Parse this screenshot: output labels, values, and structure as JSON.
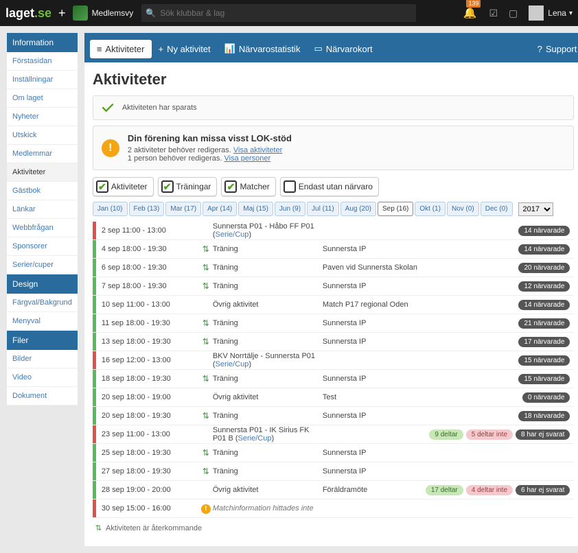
{
  "top": {
    "logo1": "laget",
    "logo2": ".se",
    "memberview": "Medlemsvy",
    "search_placeholder": "Sök klubbar & lag",
    "notif_count": "139",
    "username": "Lena"
  },
  "sidebar": {
    "sections": [
      {
        "title": "Information",
        "items": [
          "Förstasidan",
          "Inställningar",
          "Om laget",
          "Nyheter",
          "Utskick",
          "Medlemmar",
          "Aktiviteter",
          "Gästbok",
          "Länkar",
          "Webbfrågan",
          "Sponsorer",
          "Serier/cuper"
        ],
        "active": 6
      },
      {
        "title": "Design",
        "items": [
          "Färgval/Bakgrund",
          "Menyval"
        ],
        "active": -1
      },
      {
        "title": "Filer",
        "items": [
          "Bilder",
          "Video",
          "Dokument"
        ],
        "active": -1
      }
    ]
  },
  "tabs": {
    "t1": "Aktiviteter",
    "t2": "Ny aktivitet",
    "t3": "Närvarostatistik",
    "t4": "Närvarokort",
    "support": "Support"
  },
  "page_title": "Aktiviteter",
  "saved_msg": "Aktiviteten har sparats",
  "warn": {
    "title": "Din förening kan missa visst LOK-stöd",
    "line1a": "2 aktiviteter behöver redigeras. ",
    "link1": "Visa aktiviteter",
    "line2a": "1 person behöver redigeras. ",
    "link2": "Visa personer"
  },
  "filters": {
    "f1": "Aktiviteter",
    "f2": "Träningar",
    "f3": "Matcher",
    "f4": "Endast utan närvaro"
  },
  "months": [
    "Jan (10)",
    "Feb (13)",
    "Mar (17)",
    "Apr (14)",
    "Maj (15)",
    "Jun (9)",
    "Jul (11)",
    "Aug (20)",
    "Sep (16)",
    "Okt (1)",
    "Nov (0)",
    "Dec (0)"
  ],
  "month_active": 8,
  "year": "2017",
  "rows": [
    {
      "color": "red",
      "time": "2 sep 11:00 - 13:00",
      "icon": "",
      "activity_html": "Sunnersta P01 - Håbo FF P01 (<a>Serie/Cup</a>)",
      "loc": "",
      "badges": [
        {
          "t": "dark",
          "txt": "14 närvarade"
        }
      ]
    },
    {
      "color": "green",
      "time": "4 sep 18:00 - 19:30",
      "icon": "recur",
      "activity_html": "Träning",
      "loc": "Sunnersta IP",
      "badges": [
        {
          "t": "dark",
          "txt": "14 närvarade"
        }
      ]
    },
    {
      "color": "green",
      "time": "6 sep 18:00 - 19:30",
      "icon": "recur",
      "activity_html": "Träning",
      "loc": "Paven vid Sunnersta Skolan",
      "badges": [
        {
          "t": "dark",
          "txt": "20 närvarade"
        }
      ]
    },
    {
      "color": "green",
      "time": "7 sep 18:00 - 19:30",
      "icon": "recur",
      "activity_html": "Träning",
      "loc": "Sunnersta IP",
      "badges": [
        {
          "t": "dark",
          "txt": "12 närvarade"
        }
      ]
    },
    {
      "color": "green",
      "time": "10 sep 11:00 - 13:00",
      "icon": "",
      "activity_html": "Övrig aktivitet",
      "loc": "Match P17 regional Oden",
      "badges": [
        {
          "t": "dark",
          "txt": "14 närvarade"
        }
      ]
    },
    {
      "color": "green",
      "time": "11 sep 18:00 - 19:30",
      "icon": "recur",
      "activity_html": "Träning",
      "loc": "Sunnersta IP",
      "badges": [
        {
          "t": "dark",
          "txt": "21 närvarade"
        }
      ]
    },
    {
      "color": "green",
      "time": "13 sep 18:00 - 19:30",
      "icon": "recur",
      "activity_html": "Träning",
      "loc": "Sunnersta IP",
      "badges": [
        {
          "t": "dark",
          "txt": "17 närvarade"
        }
      ]
    },
    {
      "color": "red",
      "time": "16 sep 12:00 - 13:00",
      "icon": "",
      "activity_html": "BKV Norrtälje - Sunnersta P01 (<a>Serie/Cup</a>)",
      "loc": "",
      "badges": [
        {
          "t": "dark",
          "txt": "15 närvarade"
        }
      ]
    },
    {
      "color": "green",
      "time": "18 sep 18:00 - 19:30",
      "icon": "recur",
      "activity_html": "Träning",
      "loc": "Sunnersta IP",
      "badges": [
        {
          "t": "dark",
          "txt": "15 närvarade"
        }
      ]
    },
    {
      "color": "green",
      "time": "20 sep 18:00 - 19:00",
      "icon": "",
      "activity_html": "Övrig aktivitet",
      "loc": "Test",
      "badges": [
        {
          "t": "dark",
          "txt": "0 närvarade"
        }
      ]
    },
    {
      "color": "green",
      "time": "20 sep 18:00 - 19:30",
      "icon": "recur",
      "activity_html": "Träning",
      "loc": "Sunnersta IP",
      "badges": [
        {
          "t": "dark",
          "txt": "18 närvarade"
        }
      ]
    },
    {
      "color": "red",
      "time": "23 sep 11:00 - 13:00",
      "icon": "",
      "activity_html": "Sunnersta P01 - IK Sirius FK P01 B (<a>Serie/Cup</a>)",
      "loc": "",
      "badges": [
        {
          "t": "green",
          "txt": "9 deltar"
        },
        {
          "t": "pink",
          "txt": "5 deltar inte"
        },
        {
          "t": "dark",
          "txt": "8 har ej svarat"
        }
      ]
    },
    {
      "color": "green",
      "time": "25 sep 18:00 - 19:30",
      "icon": "recur",
      "activity_html": "Träning",
      "loc": "Sunnersta IP",
      "badges": []
    },
    {
      "color": "green",
      "time": "27 sep 18:00 - 19:30",
      "icon": "recur",
      "activity_html": "Träning",
      "loc": "Sunnersta IP",
      "badges": []
    },
    {
      "color": "green",
      "time": "28 sep 19:00 - 20:00",
      "icon": "",
      "activity_html": "Övrig aktivitet",
      "loc": "Föräldramöte",
      "badges": [
        {
          "t": "green",
          "txt": "17 deltar"
        },
        {
          "t": "pink",
          "txt": "4 deltar inte"
        },
        {
          "t": "dark",
          "txt": "6 har ej svarat"
        }
      ]
    },
    {
      "color": "red",
      "time": "30 sep 15:00 - 16:00",
      "icon": "warn",
      "activity_html": "<i>Matchinformation hittades inte</i>",
      "loc": "",
      "badges": []
    }
  ],
  "legend": "Aktiviteten är återkommande"
}
